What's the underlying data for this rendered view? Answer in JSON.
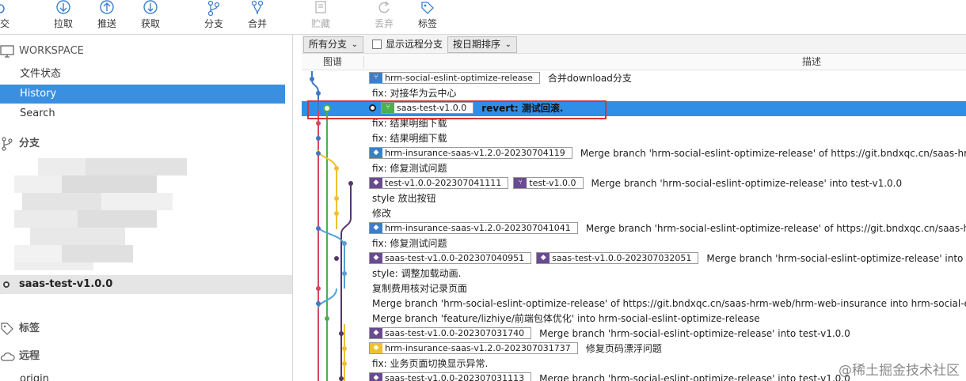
{
  "toolbar": {
    "items": [
      {
        "label": "交",
        "icon": "commit-icon"
      },
      {
        "label": "拉取",
        "icon": "pull-icon"
      },
      {
        "label": "推送",
        "icon": "push-icon"
      },
      {
        "label": "获取",
        "icon": "fetch-icon"
      },
      {
        "label": "分支",
        "icon": "branch-icon"
      },
      {
        "label": "合并",
        "icon": "merge-icon"
      },
      {
        "label": "贮藏",
        "icon": "stash-icon"
      },
      {
        "label": "丢弃",
        "icon": "discard-icon"
      },
      {
        "label": "标签",
        "icon": "tag-icon"
      }
    ]
  },
  "sidebar": {
    "workspace": "WORKSPACE",
    "items": [
      {
        "label": "文件状态"
      },
      {
        "label": "History"
      },
      {
        "label": "Search"
      }
    ],
    "branches_header": "分支",
    "current_branch": "saas-test-v1.0.0",
    "tags_header": "标签",
    "remotes_header": "远程",
    "remote_origin": "origin"
  },
  "filters": {
    "all_branches": "所有分支",
    "show_remote": "显示远程分支",
    "sort": "按日期排序"
  },
  "columns": {
    "graph": "图谱",
    "description": "描述"
  },
  "commits": [
    {
      "tags": [
        {
          "kind": "branch",
          "color": "blue",
          "name": "hrm-social-eslint-optimize-release"
        }
      ],
      "message": "合并download分支"
    },
    {
      "tags": [],
      "message": "fix: 对接华为云中心"
    },
    {
      "tags": [
        {
          "kind": "branch",
          "color": "green",
          "name": "saas-test-v1.0.0"
        }
      ],
      "message": "revert:  测试回滚."
    },
    {
      "tags": [],
      "message": "fix: 结果明细下载"
    },
    {
      "tags": [],
      "message": "fix: 结果明细下载"
    },
    {
      "tags": [
        {
          "kind": "tag",
          "color": "blue",
          "name": "hrm-insurance-saas-v1.2.0-20230704119"
        }
      ],
      "message": "Merge branch 'hrm-social-eslint-optimize-release' of https://git.bndxqc.cn/saas-hrm-w"
    },
    {
      "tags": [],
      "message": "fix: 修复测试问题"
    },
    {
      "tags": [
        {
          "kind": "tag",
          "color": "purple",
          "name": "test-v1.0.0-202307041111"
        },
        {
          "kind": "branch",
          "color": "purple",
          "name": "test-v1.0.0"
        }
      ],
      "message": "Merge branch 'hrm-social-eslint-optimize-release' into test-v1.0.0"
    },
    {
      "tags": [],
      "message": "style 放出按钮"
    },
    {
      "tags": [],
      "message": "修改"
    },
    {
      "tags": [
        {
          "kind": "tag",
          "color": "blue",
          "name": "hrm-insurance-saas-v1.2.0-202307041041"
        }
      ],
      "message": "Merge branch 'hrm-social-eslint-optimize-release' of https://git.bndxqc.cn/saas-hrm-"
    },
    {
      "tags": [],
      "message": "fix: 修复测试问题"
    },
    {
      "tags": [
        {
          "kind": "tag",
          "color": "purple",
          "name": "saas-test-v1.0.0-202307040951"
        },
        {
          "kind": "tag",
          "color": "purple",
          "name": "saas-test-v1.0.0-202307032051"
        }
      ],
      "message": "Merge branch 'hrm-social-eslint-optimize-release' into test"
    },
    {
      "tags": [],
      "message": "style: 调整加载动画."
    },
    {
      "tags": [],
      "message": "复制费用核对记录页面"
    },
    {
      "tags": [],
      "message": "Merge branch 'hrm-social-eslint-optimize-release' of https://git.bndxqc.cn/saas-hrm-web/hrm-web-insurance into hrm-social-eslin"
    },
    {
      "tags": [],
      "message": "Merge branch 'feature/lizhiye/前端包体优化' into hrm-social-eslint-optimize-release"
    },
    {
      "tags": [
        {
          "kind": "tag",
          "color": "purple",
          "name": "saas-test-v1.0.0-202307031740"
        }
      ],
      "message": "Merge branch 'hrm-social-eslint-optimize-release' into test-v1.0.0"
    },
    {
      "tags": [
        {
          "kind": "tag",
          "color": "yellow",
          "name": "hrm-insurance-saas-v1.2.0-202307031737"
        }
      ],
      "message": "修复页码漂浮问题"
    },
    {
      "tags": [],
      "message": "fix: 业务页面切换显示异常."
    },
    {
      "tags": [
        {
          "kind": "tag",
          "color": "purple",
          "name": "saas-test-v1.0.0-202307031113"
        }
      ],
      "message": "Merge branch 'hrm-social-eslint-optimize-release' into test-v1.0.0"
    }
  ],
  "watermark": "@稀土掘金技术社区"
}
